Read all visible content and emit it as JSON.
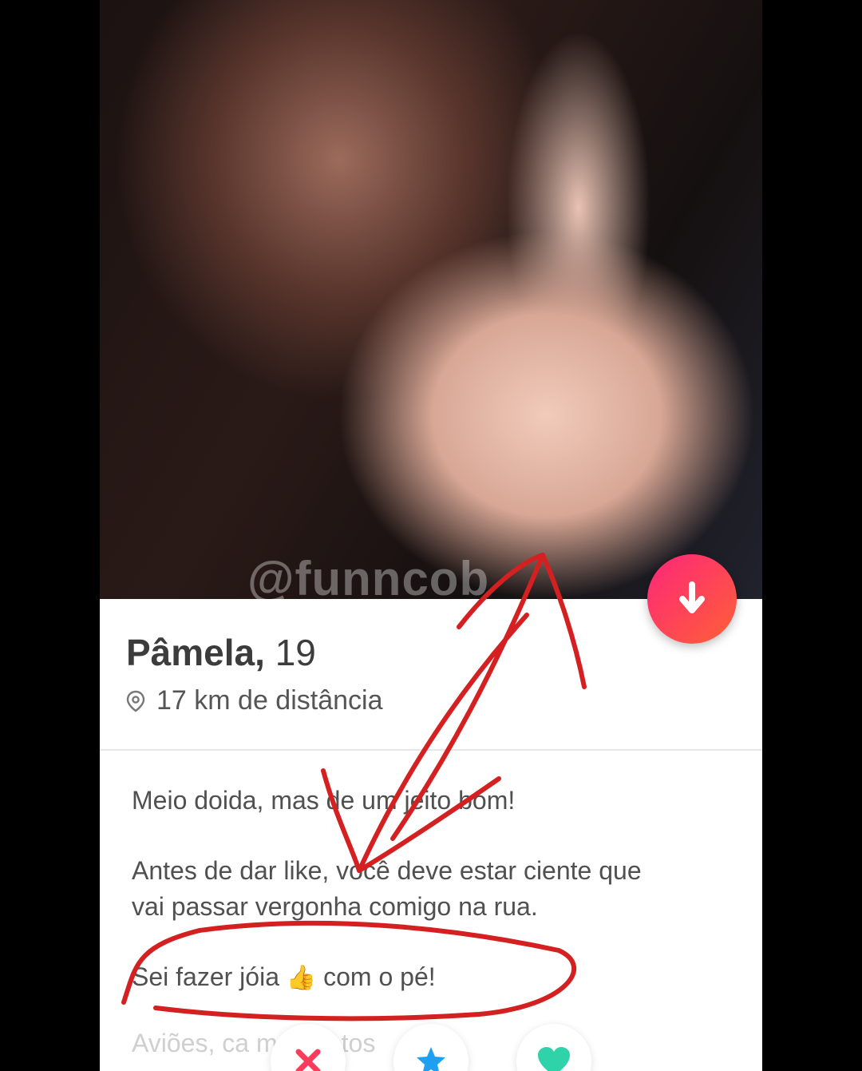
{
  "watermark": "@funncob",
  "profile": {
    "name": "Pâmela,",
    "age": "19",
    "distance": "17 km de distância"
  },
  "bio": {
    "line1": "Meio doida, mas de um jeito bom!",
    "line2": "Antes de dar like, você deve estar ciente que",
    "line3": "vai passar vergonha comigo na rua.",
    "line4_before": "Sei fazer  jóia",
    "line4_emoji": "👍",
    "line4_after": "com o pé!",
    "faded": "Aviões, ca            me       mú             tos"
  },
  "colors": {
    "brand_gradient_start": "#fd267a",
    "brand_gradient_end": "#ff6036",
    "nope": "#fd3b5b",
    "superlike": "#1f9ff2",
    "like": "#2ed3a9",
    "annotation": "#d42020"
  },
  "icons": {
    "info": "arrow-down-icon",
    "location": "location-pin-icon",
    "nope": "x-icon",
    "superlike": "star-icon",
    "like": "heart-icon"
  }
}
